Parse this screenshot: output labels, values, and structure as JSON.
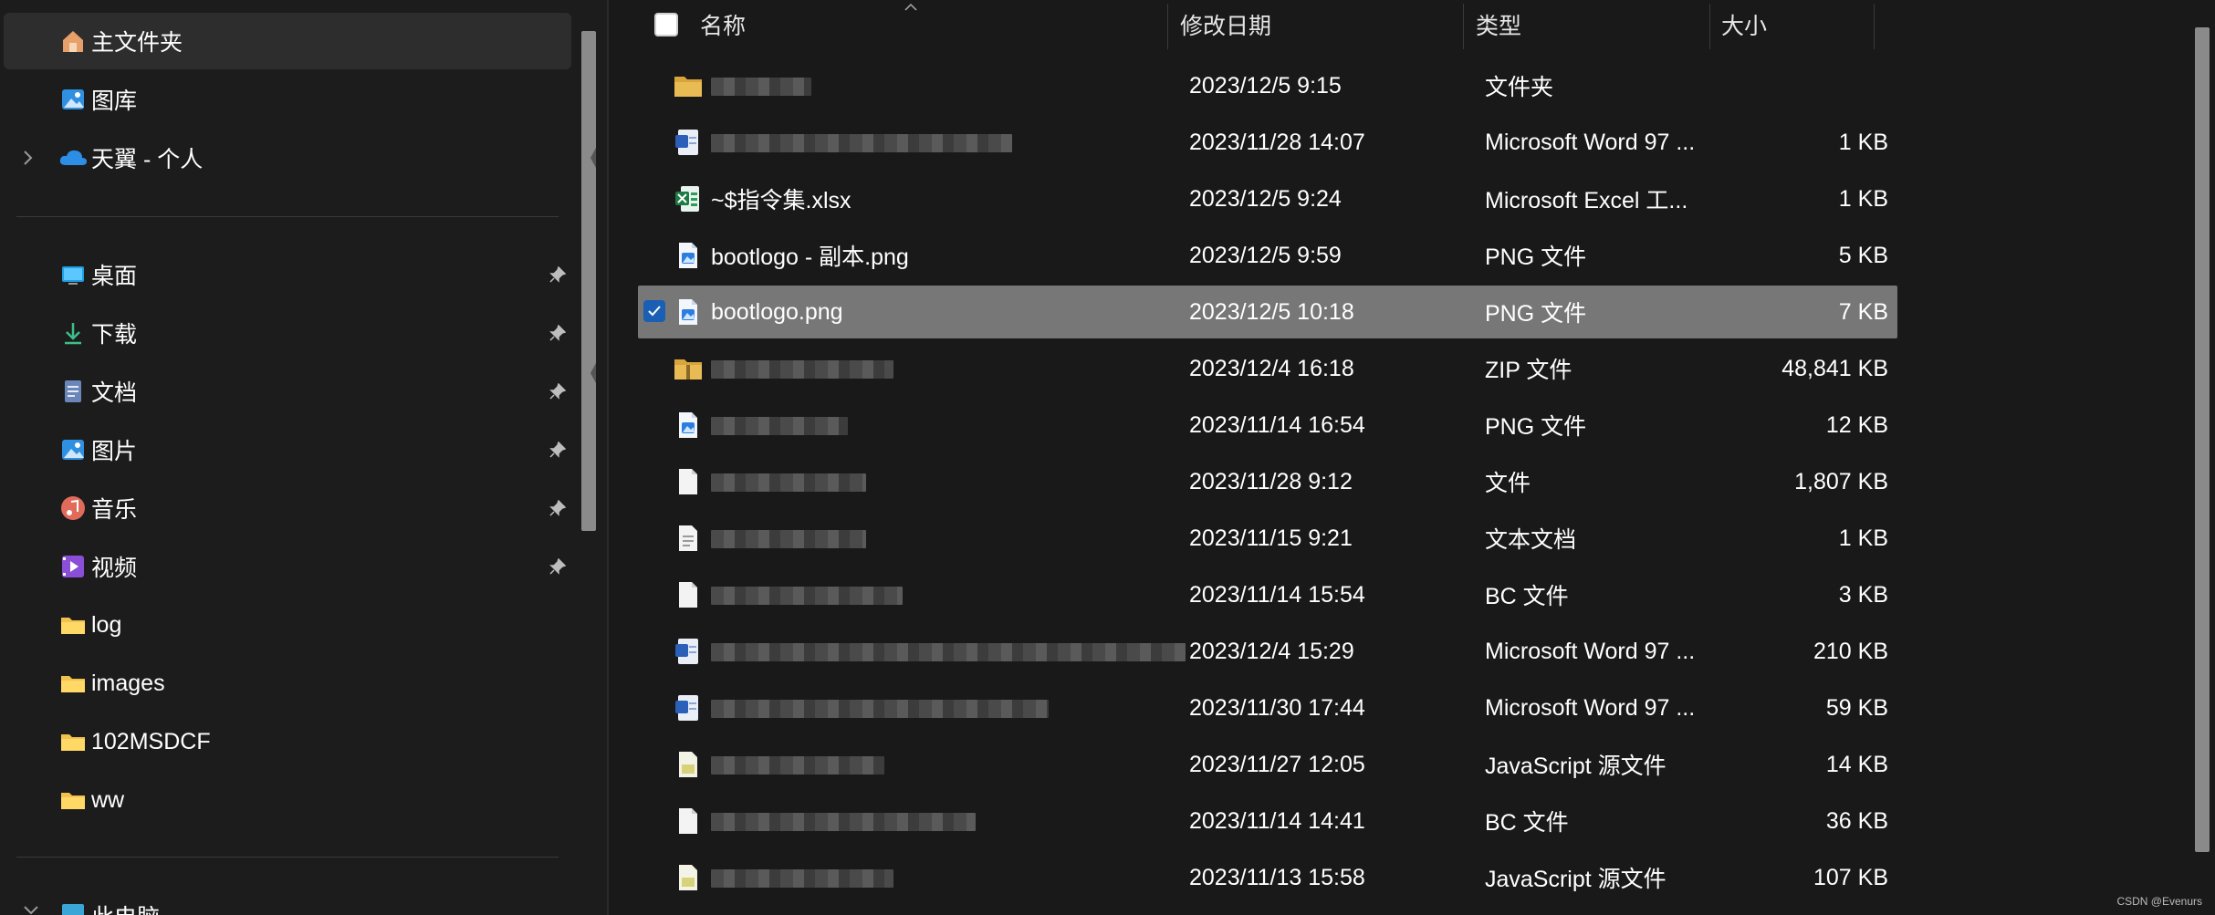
{
  "sidebar": {
    "items": [
      {
        "label": "主文件夹",
        "icon": "home-icon",
        "selected": true
      },
      {
        "label": "图库",
        "icon": "gallery-icon"
      },
      {
        "label": "天翼 - 个人",
        "icon": "cloud-icon",
        "expandable": true
      },
      {
        "label": "桌面",
        "icon": "desktop-icon",
        "pinned": true
      },
      {
        "label": "下载",
        "icon": "download-icon",
        "pinned": true
      },
      {
        "label": "文档",
        "icon": "document-icon",
        "pinned": true
      },
      {
        "label": "图片",
        "icon": "pictures-icon",
        "pinned": true
      },
      {
        "label": "音乐",
        "icon": "music-icon",
        "pinned": true
      },
      {
        "label": "视频",
        "icon": "video-icon",
        "pinned": true
      },
      {
        "label": "log",
        "icon": "folder-icon"
      },
      {
        "label": "images",
        "icon": "folder-icon"
      },
      {
        "label": "102MSDCF",
        "icon": "folder-icon"
      },
      {
        "label": "ww",
        "icon": "folder-icon"
      },
      {
        "label": "此电脑",
        "icon": "computer-icon",
        "expandable": true
      }
    ]
  },
  "columns": {
    "name": "名称",
    "modified": "修改日期",
    "type": "类型",
    "size": "大小"
  },
  "files": [
    {
      "name": "",
      "modified": "2023/12/5 9:15",
      "type": "文件夹",
      "size": "",
      "icon": "folder-icon",
      "blurred": true
    },
    {
      "name": "",
      "modified": "2023/11/28 14:07",
      "type": "Microsoft Word 97 ...",
      "size": "1 KB",
      "icon": "word-doc-icon",
      "blurred": true
    },
    {
      "name": "~$指令集.xlsx",
      "modified": "2023/12/5 9:24",
      "type": "Microsoft Excel 工...",
      "size": "1 KB",
      "icon": "excel-icon"
    },
    {
      "name": "bootlogo - 副本.png",
      "modified": "2023/12/5 9:59",
      "type": "PNG 文件",
      "size": "5 KB",
      "icon": "png-file-icon"
    },
    {
      "name": "bootlogo.png",
      "modified": "2023/12/5 10:18",
      "type": "PNG 文件",
      "size": "7 KB",
      "icon": "png-file-icon",
      "selected": true
    },
    {
      "name": "",
      "modified": "2023/12/4 16:18",
      "type": "ZIP 文件",
      "size": "48,841 KB",
      "icon": "zip-icon",
      "blurred": true
    },
    {
      "name": "",
      "modified": "2023/11/14 16:54",
      "type": "PNG 文件",
      "size": "12 KB",
      "icon": "png-file-icon",
      "blurred": true
    },
    {
      "name": "",
      "modified": "2023/11/28 9:12",
      "type": "文件",
      "size": "1,807 KB",
      "icon": "file-icon",
      "blurred": true
    },
    {
      "name": "",
      "modified": "2023/11/15 9:21",
      "type": "文本文档",
      "size": "1 KB",
      "icon": "text-file-icon",
      "blurred": true
    },
    {
      "name": "",
      "modified": "2023/11/14 15:54",
      "type": "BC 文件",
      "size": "3 KB",
      "icon": "file-icon",
      "blurred": true
    },
    {
      "name": "",
      "modified": "2023/12/4 15:29",
      "type": "Microsoft Word 97 ...",
      "size": "210 KB",
      "icon": "word-doc-icon",
      "blurred": true
    },
    {
      "name": "",
      "modified": "2023/11/30 17:44",
      "type": "Microsoft Word 97 ...",
      "size": "59 KB",
      "icon": "word-doc-icon",
      "blurred": true
    },
    {
      "name": "",
      "modified": "2023/11/27 12:05",
      "type": "JavaScript 源文件",
      "size": "14 KB",
      "icon": "js-file-icon",
      "blurred": true
    },
    {
      "name": "",
      "modified": "2023/11/14 14:41",
      "type": "BC 文件",
      "size": "36 KB",
      "icon": "file-icon",
      "blurred": true
    },
    {
      "name": "",
      "modified": "2023/11/13 15:58",
      "type": "JavaScript 源文件",
      "size": "107 KB",
      "icon": "js-file-icon",
      "blurred": true
    }
  ],
  "watermark": "CSDN @Evenurs"
}
